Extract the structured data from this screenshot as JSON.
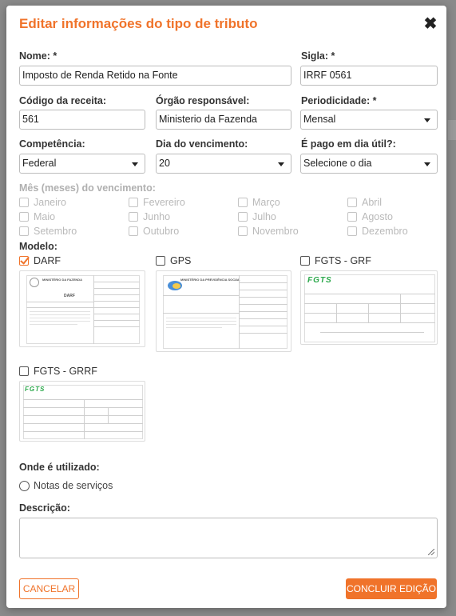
{
  "modal": {
    "title": "Editar informações do tipo de tributo",
    "close_icon": "close-icon"
  },
  "fields": {
    "nome": {
      "label": "Nome: *",
      "value": "Imposto de Renda Retido na Fonte"
    },
    "sigla": {
      "label": "Sigla: *",
      "value": "IRRF 0561"
    },
    "codigo": {
      "label": "Código da receita:",
      "value": "561"
    },
    "orgao": {
      "label": "Órgão responsável:",
      "value": "Ministerio da Fazenda"
    },
    "periodicidade": {
      "label": "Periodicidade: *",
      "value": "Mensal"
    },
    "competencia": {
      "label": "Competência:",
      "value": "Federal"
    },
    "dia_vencimento": {
      "label": "Dia do vencimento:",
      "value": "20"
    },
    "dia_util": {
      "label": "É pago em dia útil?:",
      "value": "Selecione o dia"
    }
  },
  "months": {
    "label": "Mês (meses) do vencimento:",
    "items": [
      "Janeiro",
      "Fevereiro",
      "Março",
      "Abril",
      "Maio",
      "Junho",
      "Julho",
      "Agosto",
      "Setembro",
      "Outubro",
      "Novembro",
      "Dezembro"
    ]
  },
  "modelo": {
    "label": "Modelo:",
    "options": [
      {
        "label": "DARF",
        "checked": true
      },
      {
        "label": "GPS",
        "checked": false
      },
      {
        "label": "FGTS - GRF",
        "checked": false
      },
      {
        "label": "FGTS - GRRF",
        "checked": false
      }
    ],
    "darf_heading": "MINISTÉRIO DA FAZENDA",
    "darf_doc": "DARF",
    "gps_heading": "MINISTÉRIO DA PREVIDÊNCIA SOCIAL",
    "fgts_logo": "FGTS",
    "fgts_logo_2": "FGTS"
  },
  "utilizado": {
    "label": "Onde é utilizado:",
    "option": "Notas de serviços"
  },
  "descricao": {
    "label": "Descrição:",
    "value": ""
  },
  "buttons": {
    "cancel": "CANCELAR",
    "confirm": "CONCLUIR EDIÇÃO"
  },
  "colors": {
    "accent": "#f0732a",
    "fgts_green": "#2aa84a"
  }
}
